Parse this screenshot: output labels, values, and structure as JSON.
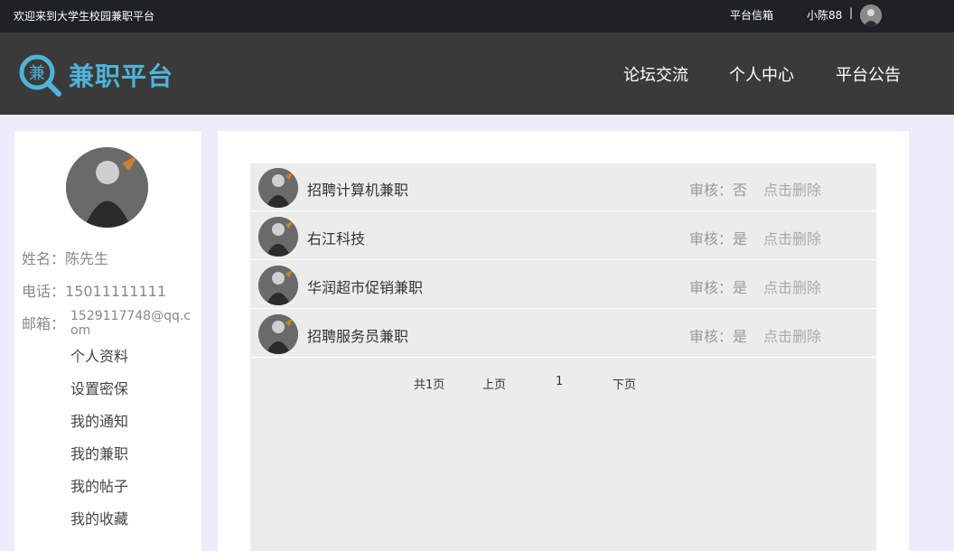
{
  "topbar": {
    "welcome": "欢迎来到大学生校园兼职平台",
    "mailbox": "平台信箱",
    "username": "小陈88",
    "separator": "|"
  },
  "header": {
    "logo_char": "兼",
    "logo_text": "兼职平台",
    "nav": [
      "论坛交流",
      "个人中心",
      "平台公告"
    ]
  },
  "profile": {
    "name_label": "姓名：",
    "name": "陈先生",
    "phone_label": "电话：",
    "phone": "15011111111",
    "email_label": "邮箱：",
    "email": "1529117748@qq.com"
  },
  "menu": [
    "个人资料",
    "设置密保",
    "我的通知",
    "我的兼职",
    "我的帖子",
    "我的收藏"
  ],
  "jobs": [
    {
      "title": "招聘计算机兼职",
      "audit": "审核：否",
      "delete": "点击删除"
    },
    {
      "title": "右江科技",
      "audit": "审核：是",
      "delete": "点击删除"
    },
    {
      "title": "华润超市促销兼职",
      "audit": "审核：是",
      "delete": "点击删除"
    },
    {
      "title": "招聘服务员兼职",
      "audit": "审核：是",
      "delete": "点击删除"
    }
  ],
  "pagination": {
    "total": "共1页",
    "prev": "上页",
    "current": "1",
    "next": "下页"
  },
  "colors": {
    "topbar_bg": "#1e2126",
    "header_bg": "#3a3a3a",
    "logo_accent": "#4fb3d9",
    "page_bg": "#ececfa",
    "list_bg": "#ececec"
  }
}
